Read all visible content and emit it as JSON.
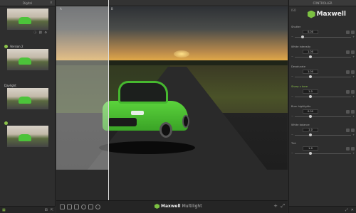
{
  "left_panel": {
    "header": "Digital",
    "cards": [
      {
        "label": "",
        "active": true
      },
      {
        "label": "Version 2",
        "active": false
      },
      {
        "label": "Daylight",
        "active": false
      },
      {
        "label": "",
        "active": false
      }
    ],
    "footer_icons": [
      "grid-icon",
      "add-icon",
      "export-icon"
    ]
  },
  "viewport": {
    "label_a": "A",
    "label_b": "B",
    "compare_split_fraction": 0.22
  },
  "toolbar": {
    "brand": "Maxwell",
    "brand_suffix": "Multilight",
    "left_tools": [
      "copy-icon",
      "crop-icon",
      "layers-icon",
      "refresh-icon",
      "adjust-icon",
      "settings-icon"
    ],
    "right_tools": [
      "plus-icon",
      "fit-icon"
    ]
  },
  "right_panel": {
    "header": "CONTROLLER",
    "top_tag": "ISO",
    "logo_text": "Maxwell",
    "controls": [
      {
        "name": "Shutter",
        "value": "0.00",
        "highlight": false,
        "level": 0.12
      },
      {
        "name": "White intensity",
        "value": "1.00",
        "highlight": false,
        "level": 0.25
      },
      {
        "name": "Desaturate",
        "value": "1.00",
        "highlight": false,
        "level": 0.25
      },
      {
        "name": "Sharp x tone",
        "value": "1.0",
        "highlight": true,
        "level": 0.25
      },
      {
        "name": "Burn highlights",
        "value": "0.00",
        "highlight": false,
        "level": 0.25
      },
      {
        "name": "White balance",
        "value": "1.0",
        "highlight": false,
        "level": 0.25
      },
      {
        "name": "Tint",
        "value": "1.0",
        "highlight": false,
        "level": 0.25
      }
    ]
  },
  "colors": {
    "accent": "#8bc34a",
    "car": "#4cc33a"
  }
}
